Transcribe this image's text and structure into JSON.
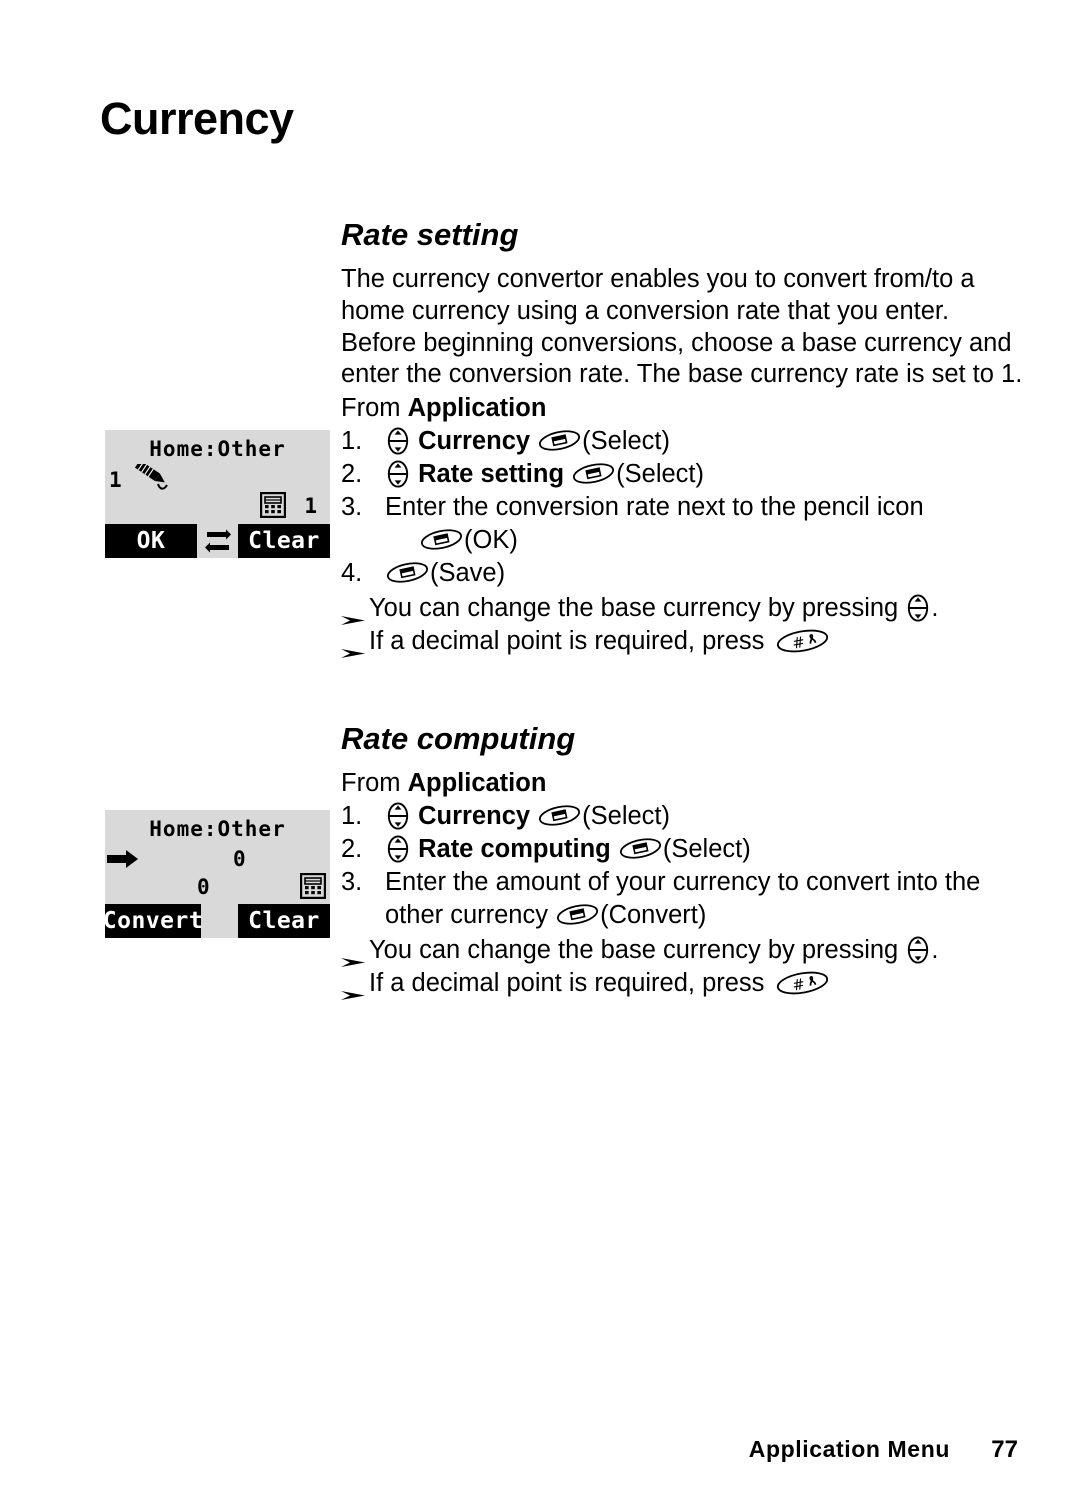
{
  "document": {
    "chapter_title": "Currency",
    "footer": {
      "label": "Application Menu",
      "page_number": "77"
    }
  },
  "icons": {
    "nav_key": "nav-updown-key-icon",
    "soft_key": "soft-key-icon",
    "hash_key": "hash-key-icon",
    "bullet": "arrow-bullet-icon",
    "pencil": "pencil-icon",
    "calculator": "calculator-icon",
    "swap": "swap-currency-icon",
    "right_arrow": "right-arrow-icon"
  },
  "sections": [
    {
      "id": "rate-setting",
      "heading": "Rate setting",
      "paragraph_lines": [
        "The currency convertor enables you to convert from/to a",
        "home currency using a conversion rate that you enter.",
        "Before beginning conversions, choose a base currency and",
        "enter the conversion rate. The base currency rate is set to 1."
      ],
      "from_prefix": "From ",
      "from_target": "Application",
      "steps": [
        {
          "num": "1.",
          "lines": [
            {
              "pre": "",
              "bold": "Currency",
              "post": "(Select)",
              "nav": true,
              "soft": true
            }
          ]
        },
        {
          "num": "2.",
          "lines": [
            {
              "pre": "",
              "bold": "Rate setting",
              "post": "(Select)",
              "nav": true,
              "soft": true
            }
          ]
        },
        {
          "num": "3.",
          "lines": [
            {
              "pre": "Enter the conversion rate next to the pencil icon",
              "bold": "",
              "post": "",
              "nav": false,
              "soft": false
            },
            {
              "pre": "",
              "bold": "",
              "post": "(OK)",
              "nav": false,
              "soft": true,
              "indent": true
            }
          ]
        },
        {
          "num": "4.",
          "lines": [
            {
              "pre": "",
              "bold": "",
              "post": "(Save)",
              "nav": false,
              "soft": true
            }
          ]
        }
      ],
      "notes": [
        {
          "text_before": "You can change the base currency by pressing ",
          "icon": "nav",
          "text_after": "."
        },
        {
          "text_before": "If a decimal point is required, press ",
          "icon": "hash",
          "text_after": ""
        }
      ],
      "phone": {
        "title": "Home:Other",
        "left_value": "1",
        "right_value": "1",
        "pencil_icon": true,
        "calculator_icon": true,
        "right_arrow": false,
        "softkeys": {
          "left": "OK",
          "right": "Clear",
          "swap_icon": true
        },
        "lower_value": ""
      }
    },
    {
      "id": "rate-computing",
      "heading": "Rate computing",
      "paragraph_lines": [],
      "from_prefix": "From ",
      "from_target": "Application",
      "steps": [
        {
          "num": "1.",
          "lines": [
            {
              "pre": "",
              "bold": "Currency",
              "post": "(Select)",
              "nav": true,
              "soft": true
            }
          ]
        },
        {
          "num": "2.",
          "lines": [
            {
              "pre": "",
              "bold": "Rate computing",
              "post": "(Select)",
              "nav": true,
              "soft": true
            }
          ]
        },
        {
          "num": "3.",
          "lines": [
            {
              "pre": "Enter the amount of your currency to convert into the",
              "bold": "",
              "post": "",
              "nav": false,
              "soft": false
            },
            {
              "pre": "other currency ",
              "bold": "",
              "post": "(Convert)",
              "nav": false,
              "soft": true,
              "indent": true
            }
          ]
        }
      ],
      "notes": [
        {
          "text_before": "You can change the base currency by pressing ",
          "icon": "nav",
          "text_after": "."
        },
        {
          "text_before": "If a decimal point is required, press ",
          "icon": "hash",
          "text_after": ""
        }
      ],
      "phone": {
        "title": "Home:Other",
        "left_value": "",
        "right_value": "0",
        "pencil_icon": false,
        "calculator_icon": true,
        "right_arrow": true,
        "softkeys": {
          "left": "Convert",
          "right": "Clear",
          "swap_icon": false
        },
        "lower_value": "0"
      }
    }
  ],
  "colors": {
    "lcd_background": "#d9d9d9",
    "lcd_softkey": "#000000",
    "text": "#000000",
    "page_background": "#ffffff"
  }
}
